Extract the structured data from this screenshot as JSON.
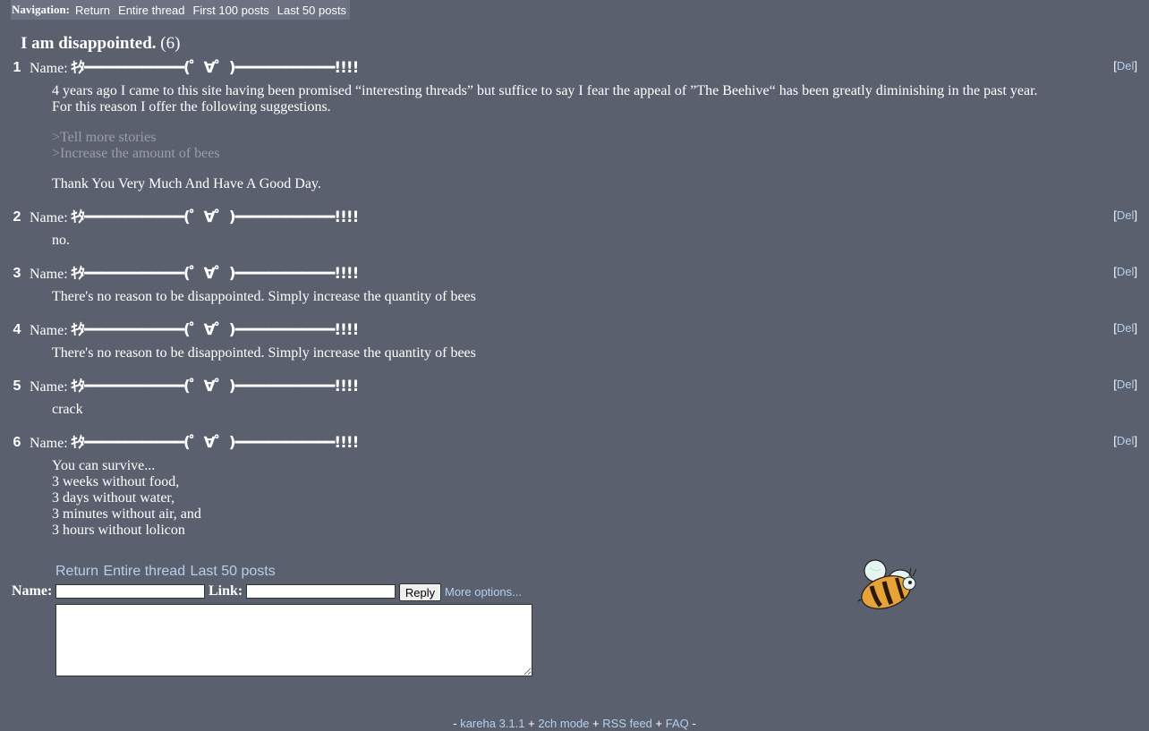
{
  "nav": {
    "label": "Navigation:",
    "links": [
      "Return",
      "Entire thread",
      "First 100 posts",
      "Last 50 posts"
    ]
  },
  "thread": {
    "title": "I am disappointed.",
    "count": "(6)"
  },
  "posts": [
    {
      "num": "1",
      "name_label": "Name:",
      "name": "ｷﾀ━━━━━━━━━━━━(゜∀゜)━━━━━━━━━━━━!!!!",
      "del": "Del",
      "lines": [
        "4 years ago I came to this site having been promised “interesting threads” but suffice to say I fear the appeal of ”The Beehive“ has been greatly diminishing in the past year.",
        "For this reason I offer the following suggestions."
      ],
      "quotes": [
        ">Tell more stories",
        ">Increase the amount of bees"
      ],
      "closing": "Thank You Very Much And Have A Good Day."
    },
    {
      "num": "2",
      "name_label": "Name:",
      "name": "ｷﾀ━━━━━━━━━━━━(゜∀゜)━━━━━━━━━━━━!!!!",
      "del": "Del",
      "lines": [
        "no."
      ]
    },
    {
      "num": "3",
      "name_label": "Name:",
      "name": "ｷﾀ━━━━━━━━━━━━(゜∀゜)━━━━━━━━━━━━!!!!",
      "del": "Del",
      "lines": [
        "There's no reason to be disappointed. Simply increase the quantity of bees"
      ]
    },
    {
      "num": "4",
      "name_label": "Name:",
      "name": "ｷﾀ━━━━━━━━━━━━(゜∀゜)━━━━━━━━━━━━!!!!",
      "del": "Del",
      "lines": [
        "There's no reason to be disappointed. Simply increase the quantity of bees"
      ]
    },
    {
      "num": "5",
      "name_label": "Name:",
      "name": "ｷﾀ━━━━━━━━━━━━(゜∀゜)━━━━━━━━━━━━!!!!",
      "del": "Del",
      "lines": [
        "crack"
      ]
    },
    {
      "num": "6",
      "name_label": "Name:",
      "name": "ｷﾀ━━━━━━━━━━━━(゜∀゜)━━━━━━━━━━━━!!!!",
      "del": "Del",
      "lines": [
        "You can survive...",
        "3 weeks without food,",
        "3 days without water,",
        "3 minutes without air, and",
        "3 hours without lolicon"
      ]
    }
  ],
  "form": {
    "links": [
      "Return",
      "Entire thread",
      "Last 50 posts"
    ],
    "name_label": "Name:",
    "link_label": "Link:",
    "name_value": "",
    "link_value": "",
    "reply_label": "Reply",
    "more_options": "More options...",
    "comment_value": ""
  },
  "footer": {
    "lead": "-",
    "links": [
      "kareha 3.1.1",
      "2ch mode",
      "RSS feed",
      "FAQ"
    ],
    "sep": "+",
    "trail": "-"
  },
  "colors": {
    "background": "#5b606e",
    "navbar": "#6c7282",
    "link": "#b3d1ee",
    "quote": "#9a9ea8"
  },
  "icons": {
    "mascot": "bee-icon"
  }
}
